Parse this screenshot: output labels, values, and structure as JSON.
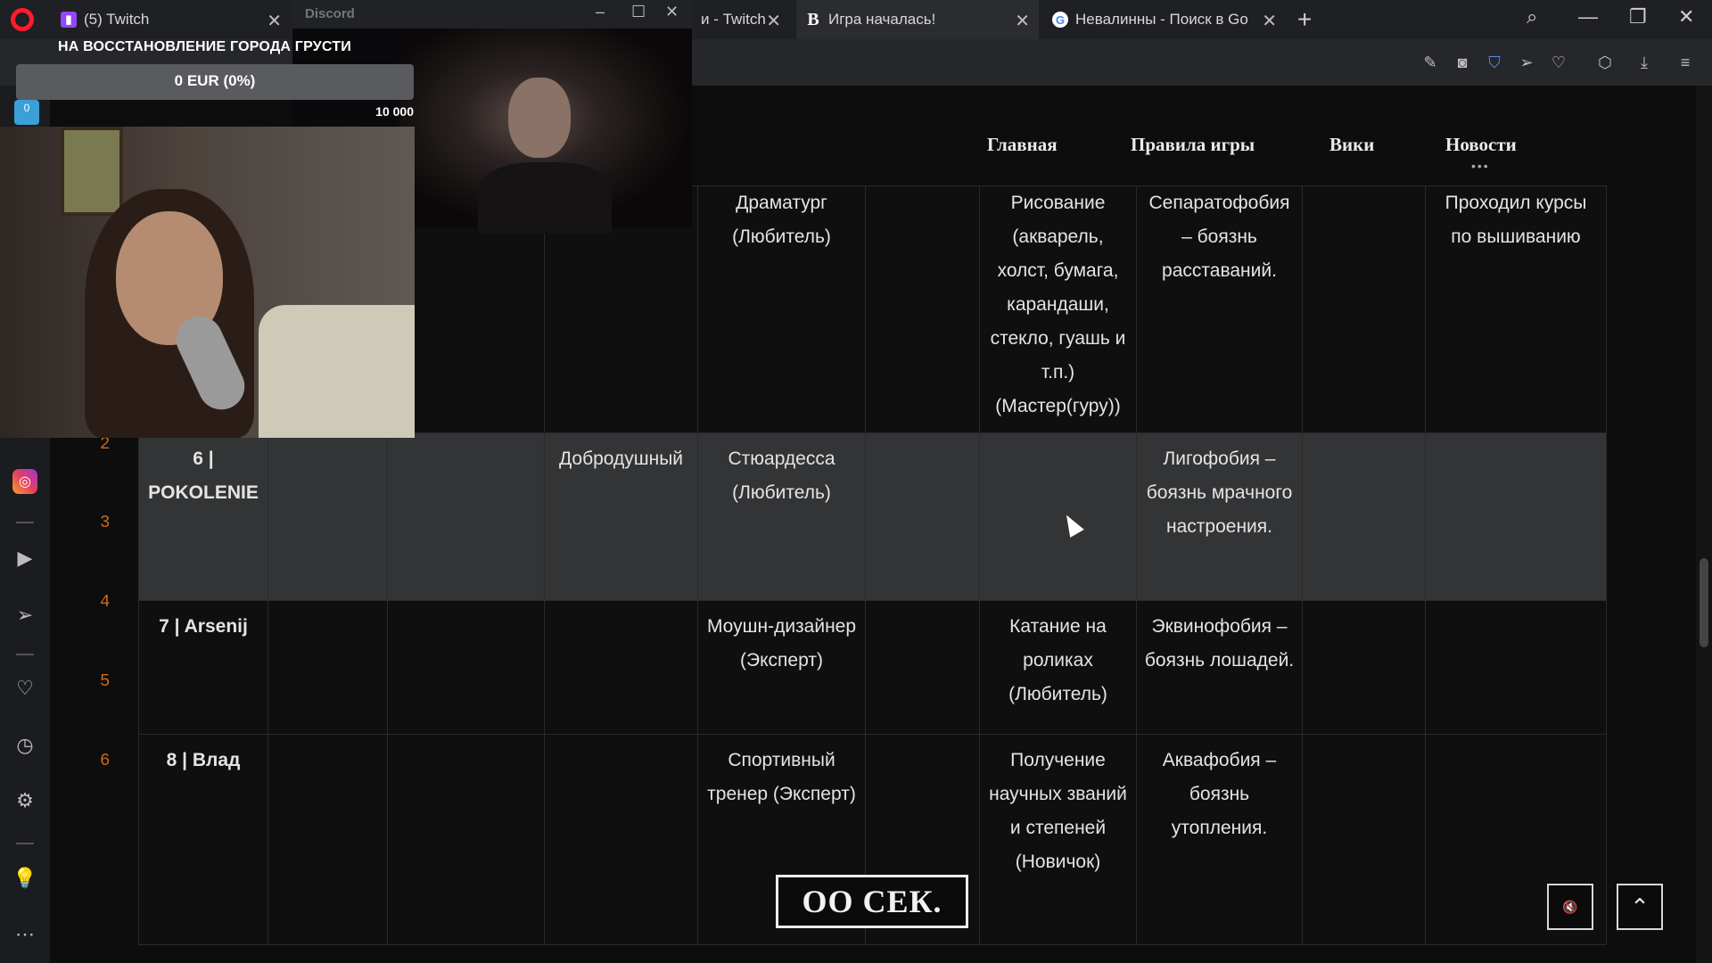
{
  "browser": {
    "tabs": [
      {
        "label": "(5) Twitch",
        "icon": "twitch-icon"
      },
      {
        "label": "и - Twitch",
        "icon": "twitch-icon"
      },
      {
        "label": "Игра началась!",
        "icon": "b-site-icon"
      },
      {
        "label": "Невалинны - Поиск в Go",
        "icon": "google-icon"
      }
    ],
    "accent": "#ff1b2d"
  },
  "discord": {
    "title": "Discord"
  },
  "stream_goal": {
    "title": "НА ВОССТАНОВЛЕНИЕ ГОРОДА ГРУСТИ",
    "current": "0 EUR (0%)",
    "progress_percent": 0,
    "target": "10 000",
    "min_badge": "0"
  },
  "gutter_numbers": [
    "2",
    "3",
    "4",
    "5",
    "6"
  ],
  "site_nav": [
    "Главная",
    "Правила игры",
    "Вики",
    "Новости"
  ],
  "table": {
    "rows": [
      {
        "cells": [
          "",
          "",
          "",
          "",
          "Драматург (Любитель)",
          "",
          "Рисование (акварель, холст, бумага, карандаши, стекло, гуашь и т.п.) (Мастер(гуру))",
          "Сепаратофобия – боязнь расставаний.",
          "",
          "Проходил курсы по вышиванию"
        ]
      },
      {
        "cells": [
          "6 | POKOLENIE",
          "",
          "",
          "Добродушный",
          "Стюардесса (Любитель)",
          "",
          "",
          "Лигофобия – боязнь мрачного настроения.",
          "",
          ""
        ]
      },
      {
        "cells": [
          "7 | Arsenij",
          "",
          "",
          "",
          "Моушн-дизайнер (Эксперт)",
          "",
          "Катание на роликах (Любитель)",
          "Эквинофобия – боязнь лошадей.",
          "",
          ""
        ]
      },
      {
        "cells": [
          "8 | Влад",
          "",
          "",
          "",
          "Спортивный тренер (Эксперт)",
          "",
          "Получение научных званий и степеней (Новичок)",
          "Аквафобия – боязнь утопления.",
          "",
          ""
        ]
      }
    ]
  },
  "timer": {
    "label": "ОО СЕК."
  },
  "fab": {
    "mute": "🔇",
    "up": "⌃"
  }
}
